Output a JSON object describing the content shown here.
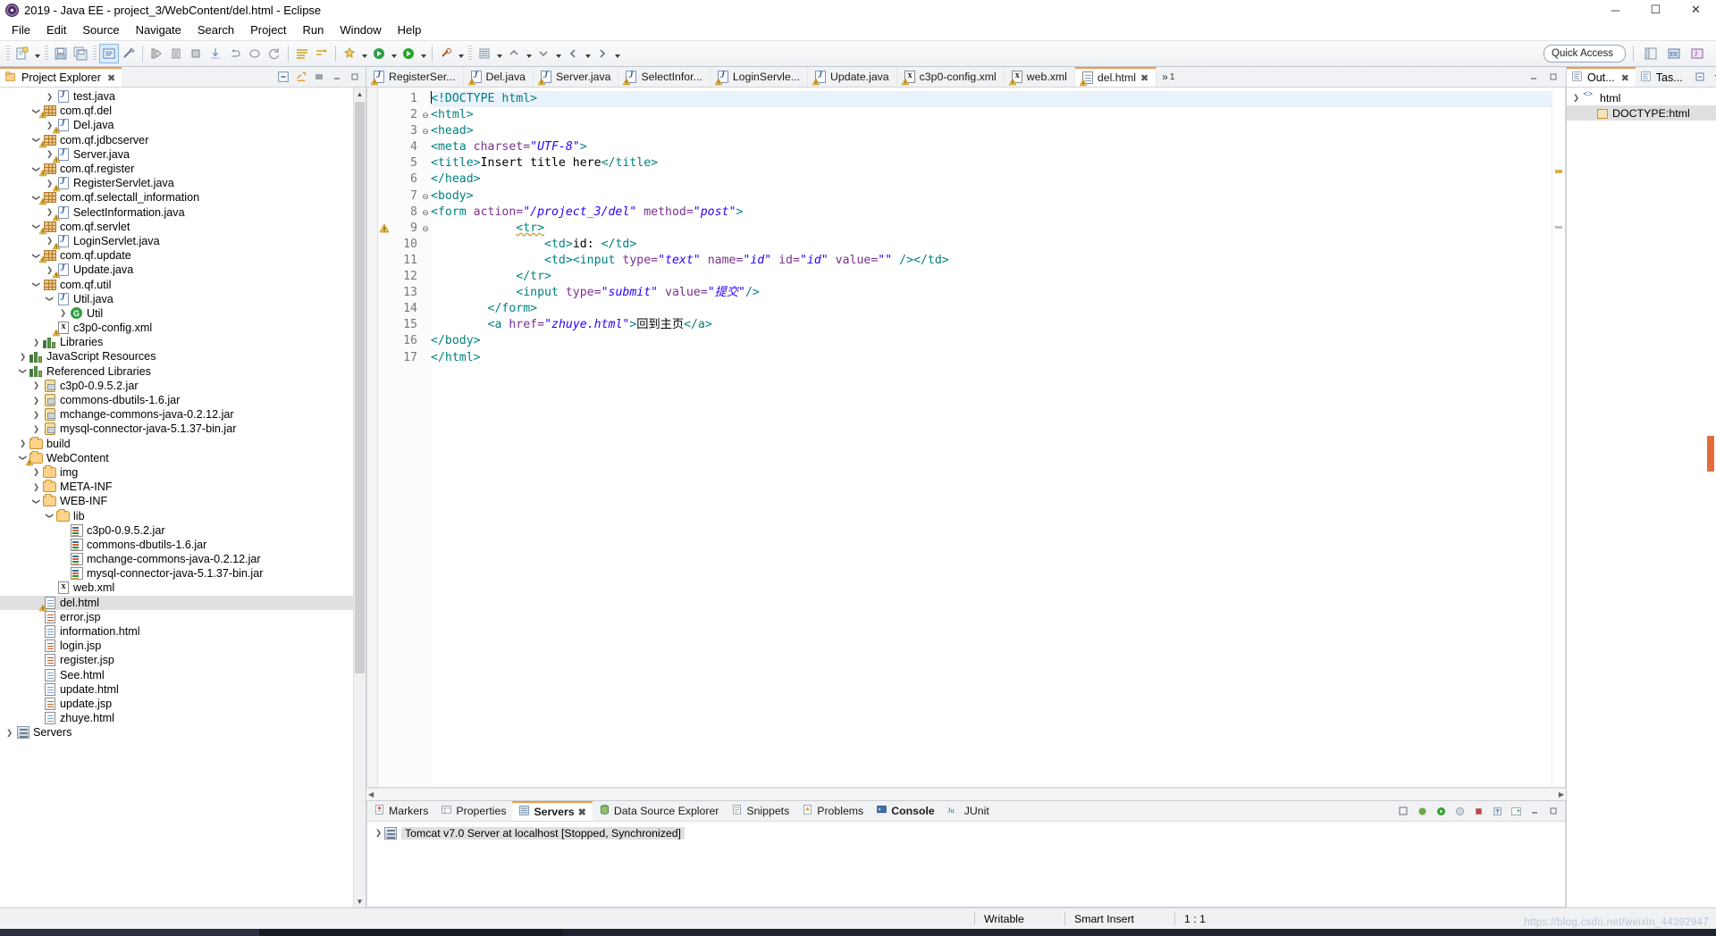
{
  "window": {
    "title": "2019 - Java EE - project_3/WebContent/del.html - Eclipse",
    "minimize_label": "─",
    "maximize_label": "☐",
    "close_label": "✕",
    "logo_icon": "eclipse-logo-icon"
  },
  "menubar": {
    "items": [
      "File",
      "Edit",
      "Source",
      "Navigate",
      "Search",
      "Project",
      "Run",
      "Window",
      "Help"
    ]
  },
  "toolbar": {
    "quick_access_placeholder": "Quick Access",
    "perspective_icons": [
      "java-ee-perspective-icon",
      "java-perspective-icon",
      "open-perspective-icon"
    ]
  },
  "project_explorer": {
    "tab_label": "Project Explorer",
    "close_label": "✖",
    "tools": [
      "collapse-all-icon",
      "link-with-editor-icon",
      "view-menu-icon",
      "minimize-icon",
      "maximize-icon"
    ],
    "tree": [
      {
        "indent": 3,
        "arrow": "right",
        "icon": "java-file-icon",
        "label": "test.java",
        "warn": false
      },
      {
        "indent": 2,
        "arrow": "down",
        "icon": "package-icon",
        "label": "com.qf.del",
        "warn": true
      },
      {
        "indent": 3,
        "arrow": "right",
        "icon": "java-file-icon",
        "label": "Del.java",
        "warn": true
      },
      {
        "indent": 2,
        "arrow": "down",
        "icon": "package-icon",
        "label": "com.qf.jdbcserver",
        "warn": true
      },
      {
        "indent": 3,
        "arrow": "right",
        "icon": "java-file-icon",
        "label": "Server.java",
        "warn": true
      },
      {
        "indent": 2,
        "arrow": "down",
        "icon": "package-icon",
        "label": "com.qf.register",
        "warn": true
      },
      {
        "indent": 3,
        "arrow": "right",
        "icon": "java-file-icon",
        "label": "RegisterServlet.java",
        "warn": true
      },
      {
        "indent": 2,
        "arrow": "down",
        "icon": "package-icon",
        "label": "com.qf.selectall_information",
        "warn": true
      },
      {
        "indent": 3,
        "arrow": "right",
        "icon": "java-file-icon",
        "label": "SelectInformation.java",
        "warn": true
      },
      {
        "indent": 2,
        "arrow": "down",
        "icon": "package-icon",
        "label": "com.qf.servlet",
        "warn": true
      },
      {
        "indent": 3,
        "arrow": "right",
        "icon": "java-file-icon",
        "label": "LoginServlet.java",
        "warn": true
      },
      {
        "indent": 2,
        "arrow": "down",
        "icon": "package-icon",
        "label": "com.qf.update",
        "warn": true
      },
      {
        "indent": 3,
        "arrow": "right",
        "icon": "java-file-icon",
        "label": "Update.java",
        "warn": true
      },
      {
        "indent": 2,
        "arrow": "down",
        "icon": "package-icon",
        "label": "com.qf.util",
        "warn": false
      },
      {
        "indent": 3,
        "arrow": "down",
        "icon": "java-file-icon",
        "label": "Util.java",
        "warn": false
      },
      {
        "indent": 4,
        "arrow": "right",
        "icon": "class-icon",
        "label": "Util",
        "warn": false
      },
      {
        "indent": 3,
        "arrow": "none",
        "icon": "xml-file-icon",
        "label": "c3p0-config.xml",
        "warn": true
      },
      {
        "indent": 2,
        "arrow": "right",
        "icon": "library-icon",
        "label": "Libraries",
        "warn": false
      },
      {
        "indent": 1,
        "arrow": "right",
        "icon": "library-icon",
        "label": "JavaScript Resources",
        "warn": false
      },
      {
        "indent": 1,
        "arrow": "down",
        "icon": "library-icon",
        "label": "Referenced Libraries",
        "warn": false
      },
      {
        "indent": 2,
        "arrow": "right",
        "icon": "jar-icon",
        "label": "c3p0-0.9.5.2.jar",
        "warn": false
      },
      {
        "indent": 2,
        "arrow": "right",
        "icon": "jar-icon",
        "label": "commons-dbutils-1.6.jar",
        "warn": false
      },
      {
        "indent": 2,
        "arrow": "right",
        "icon": "jar-icon",
        "label": "mchange-commons-java-0.2.12.jar",
        "warn": false
      },
      {
        "indent": 2,
        "arrow": "right",
        "icon": "jar-icon",
        "label": "mysql-connector-java-5.1.37-bin.jar",
        "warn": false
      },
      {
        "indent": 1,
        "arrow": "right",
        "icon": "folder-icon",
        "label": "build",
        "warn": false
      },
      {
        "indent": 1,
        "arrow": "down",
        "icon": "folder-icon",
        "label": "WebContent",
        "warn": true
      },
      {
        "indent": 2,
        "arrow": "right",
        "icon": "folder-icon",
        "label": "img",
        "warn": false
      },
      {
        "indent": 2,
        "arrow": "right",
        "icon": "folder-icon",
        "label": "META-INF",
        "warn": false
      },
      {
        "indent": 2,
        "arrow": "down",
        "icon": "folder-icon",
        "label": "WEB-INF",
        "warn": false
      },
      {
        "indent": 3,
        "arrow": "down",
        "icon": "folder-icon",
        "label": "lib",
        "warn": false
      },
      {
        "indent": 4,
        "arrow": "none",
        "icon": "jar-java-icon",
        "label": "c3p0-0.9.5.2.jar",
        "warn": false
      },
      {
        "indent": 4,
        "arrow": "none",
        "icon": "jar-java-icon",
        "label": "commons-dbutils-1.6.jar",
        "warn": false
      },
      {
        "indent": 4,
        "arrow": "none",
        "icon": "jar-java-icon",
        "label": "mchange-commons-java-0.2.12.jar",
        "warn": false
      },
      {
        "indent": 4,
        "arrow": "none",
        "icon": "jar-java-icon",
        "label": "mysql-connector-java-5.1.37-bin.jar",
        "warn": false
      },
      {
        "indent": 3,
        "arrow": "none",
        "icon": "xml-file-icon",
        "label": "web.xml",
        "warn": false
      },
      {
        "indent": 2,
        "arrow": "none",
        "icon": "html-file-icon",
        "label": "del.html",
        "warn": true,
        "selected": true
      },
      {
        "indent": 2,
        "arrow": "none",
        "icon": "jsp-file-icon",
        "label": "error.jsp",
        "warn": false
      },
      {
        "indent": 2,
        "arrow": "none",
        "icon": "html-file-icon",
        "label": "information.html",
        "warn": false
      },
      {
        "indent": 2,
        "arrow": "none",
        "icon": "jsp-file-icon",
        "label": "login.jsp",
        "warn": false
      },
      {
        "indent": 2,
        "arrow": "none",
        "icon": "jsp-file-icon",
        "label": "register.jsp",
        "warn": false
      },
      {
        "indent": 2,
        "arrow": "none",
        "icon": "html-file-icon",
        "label": "See.html",
        "warn": false
      },
      {
        "indent": 2,
        "arrow": "none",
        "icon": "html-file-icon",
        "label": "update.html",
        "warn": false
      },
      {
        "indent": 2,
        "arrow": "none",
        "icon": "jsp-file-icon",
        "label": "update.jsp",
        "warn": false
      },
      {
        "indent": 2,
        "arrow": "none",
        "icon": "html-file-icon",
        "label": "zhuye.html",
        "warn": false
      },
      {
        "indent": 0,
        "arrow": "right",
        "icon": "server-icon",
        "label": "Servers",
        "warn": false
      }
    ]
  },
  "editor": {
    "tabs": [
      {
        "label": "RegisterSer...",
        "icon": "java-file-icon",
        "active": false
      },
      {
        "label": "Del.java",
        "icon": "java-file-icon",
        "active": false
      },
      {
        "label": "Server.java",
        "icon": "java-file-icon",
        "active": false
      },
      {
        "label": "SelectInfor...",
        "icon": "java-file-icon",
        "active": false
      },
      {
        "label": "LoginServle...",
        "icon": "java-file-icon",
        "active": false
      },
      {
        "label": "Update.java",
        "icon": "java-file-icon",
        "active": false
      },
      {
        "label": "c3p0-config.xml",
        "icon": "xml-file-icon",
        "active": false
      },
      {
        "label": "web.xml",
        "icon": "xml-file-icon",
        "active": false
      },
      {
        "label": "del.html",
        "icon": "html-file-icon",
        "active": true,
        "close_label": "✖"
      }
    ],
    "more_tabs_label": "»",
    "overflow_count": "1",
    "tools": [
      "minimize-icon",
      "maximize-icon"
    ],
    "line_numbers": [
      "1",
      "2",
      "3",
      "4",
      "5",
      "6",
      "7",
      "8",
      "9",
      "10",
      "11",
      "12",
      "13",
      "14",
      "15",
      "16",
      "17"
    ],
    "fold_markers": {
      "2": true,
      "3": true,
      "7": true,
      "8": true,
      "9": true
    },
    "warning_line": 9,
    "lines": [
      {
        "n": 1,
        "current": true,
        "caret": true,
        "segs": [
          {
            "t": "<!DOCTYPE html>",
            "c": "tagc"
          }
        ]
      },
      {
        "n": 2,
        "segs": [
          {
            "t": "<html>",
            "c": "tagc"
          }
        ]
      },
      {
        "n": 3,
        "segs": [
          {
            "t": "<head>",
            "c": "tagc"
          }
        ]
      },
      {
        "n": 4,
        "segs": [
          {
            "t": "<meta ",
            "c": "tagc"
          },
          {
            "t": "charset=",
            "c": "attr"
          },
          {
            "t": "\"UTF-8\"",
            "c": "val"
          },
          {
            "t": ">",
            "c": "tagc"
          }
        ]
      },
      {
        "n": 5,
        "segs": [
          {
            "t": "<title>",
            "c": "tagc"
          },
          {
            "t": "Insert title here",
            "c": "txt"
          },
          {
            "t": "</title>",
            "c": "tagc"
          }
        ]
      },
      {
        "n": 6,
        "segs": [
          {
            "t": "</head>",
            "c": "tagc"
          }
        ]
      },
      {
        "n": 7,
        "segs": [
          {
            "t": "<body>",
            "c": "tagc"
          }
        ]
      },
      {
        "n": 8,
        "segs": [
          {
            "t": "<form ",
            "c": "tagc"
          },
          {
            "t": "action=",
            "c": "attr"
          },
          {
            "t": "\"/project_3/del\"",
            "c": "val"
          },
          {
            "t": " ",
            "c": "txt"
          },
          {
            "t": "method=",
            "c": "attr"
          },
          {
            "t": "\"post\"",
            "c": "val"
          },
          {
            "t": ">",
            "c": "tagc"
          }
        ]
      },
      {
        "n": 9,
        "segs": [
          {
            "t": "            ",
            "c": "txt"
          },
          {
            "t": "<tr>",
            "c": "tagc sqg"
          }
        ]
      },
      {
        "n": 10,
        "segs": [
          {
            "t": "                ",
            "c": "txt"
          },
          {
            "t": "<td>",
            "c": "tagc"
          },
          {
            "t": "id: ",
            "c": "txt"
          },
          {
            "t": "</td>",
            "c": "tagc"
          }
        ]
      },
      {
        "n": 11,
        "segs": [
          {
            "t": "                ",
            "c": "txt"
          },
          {
            "t": "<td><input ",
            "c": "tagc"
          },
          {
            "t": "type=",
            "c": "attr"
          },
          {
            "t": "\"text\"",
            "c": "val"
          },
          {
            "t": " ",
            "c": "txt"
          },
          {
            "t": "name=",
            "c": "attr"
          },
          {
            "t": "\"id\"",
            "c": "val"
          },
          {
            "t": " ",
            "c": "txt"
          },
          {
            "t": "id=",
            "c": "attr"
          },
          {
            "t": "\"id\"",
            "c": "val"
          },
          {
            "t": " ",
            "c": "txt"
          },
          {
            "t": "value=",
            "c": "attr"
          },
          {
            "t": "\"\"",
            "c": "val"
          },
          {
            "t": " /></td>",
            "c": "tagc"
          }
        ]
      },
      {
        "n": 12,
        "segs": [
          {
            "t": "            ",
            "c": "txt"
          },
          {
            "t": "</tr>",
            "c": "tagc"
          }
        ]
      },
      {
        "n": 13,
        "segs": [
          {
            "t": "            ",
            "c": "txt"
          },
          {
            "t": "<input ",
            "c": "tagc"
          },
          {
            "t": "type=",
            "c": "attr"
          },
          {
            "t": "\"submit\"",
            "c": "val"
          },
          {
            "t": " ",
            "c": "txt"
          },
          {
            "t": "value=",
            "c": "attr"
          },
          {
            "t": "\"提交\"",
            "c": "val"
          },
          {
            "t": "/>",
            "c": "tagc"
          }
        ]
      },
      {
        "n": 14,
        "segs": [
          {
            "t": "        ",
            "c": "txt"
          },
          {
            "t": "</form>",
            "c": "tagc"
          }
        ]
      },
      {
        "n": 15,
        "segs": [
          {
            "t": "        ",
            "c": "txt"
          },
          {
            "t": "<a ",
            "c": "tagc"
          },
          {
            "t": "href=",
            "c": "attr"
          },
          {
            "t": "\"zhuye.html\"",
            "c": "val"
          },
          {
            "t": ">",
            "c": "tagc"
          },
          {
            "t": "回到主页",
            "c": "txt"
          },
          {
            "t": "</a>",
            "c": "tagc"
          }
        ]
      },
      {
        "n": 16,
        "segs": [
          {
            "t": "</body>",
            "c": "tagc"
          }
        ]
      },
      {
        "n": 17,
        "segs": [
          {
            "t": "</html>",
            "c": "tagc"
          }
        ]
      }
    ]
  },
  "bottom_panel": {
    "tabs": [
      {
        "label": "Markers",
        "icon": "markers-icon",
        "active": false
      },
      {
        "label": "Properties",
        "icon": "properties-icon",
        "active": false
      },
      {
        "label": "Servers",
        "icon": "servers-icon",
        "active": true,
        "close_label": "✖"
      },
      {
        "label": "Data Source Explorer",
        "icon": "data-source-icon",
        "active": false
      },
      {
        "label": "Snippets",
        "icon": "snippets-icon",
        "active": false
      },
      {
        "label": "Problems",
        "icon": "problems-icon",
        "active": false
      },
      {
        "label": "Console",
        "icon": "console-icon",
        "active": false,
        "bold": true
      },
      {
        "label": "JUnit",
        "icon": "junit-icon",
        "active": false
      }
    ],
    "tools": [
      "start-server-icon",
      "debug-icon",
      "stop-icon",
      "publish-icon",
      "add-remove-icon",
      "view-menu-icon",
      "minimize-icon",
      "maximize-icon"
    ],
    "server_row": {
      "arrow": "right",
      "icon": "tomcat-server-icon",
      "label": "Tomcat v7.0 Server at localhost  [Stopped, Synchronized]"
    }
  },
  "outline": {
    "tabs": [
      {
        "label": "Out...",
        "icon": "outline-icon",
        "active": true,
        "close_label": "✖"
      },
      {
        "label": "Tas...",
        "icon": "tasks-icon",
        "active": false
      }
    ],
    "tools": [
      "collapse-all-icon",
      "view-menu-icon"
    ],
    "rows": [
      {
        "indent": 1,
        "arrow": "none",
        "icon": "doctype-icon",
        "label": "DOCTYPE:html",
        "selected": true
      },
      {
        "indent": 0,
        "arrow": "right",
        "icon": "html-tag-icon",
        "label": "html",
        "selected": false
      }
    ]
  },
  "statusbar": {
    "writable": "Writable",
    "insert_mode": "Smart Insert",
    "position": "1 : 1",
    "watermark": "https://blog.csdn.net/weixin_44392947"
  }
}
